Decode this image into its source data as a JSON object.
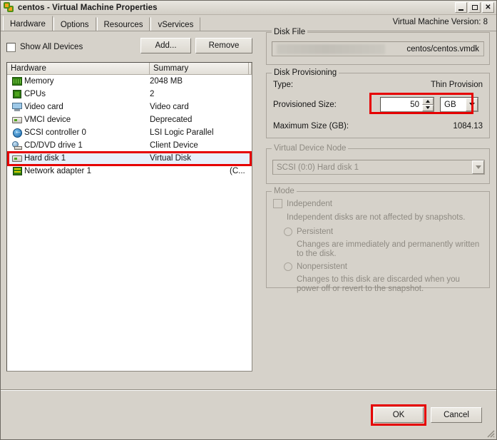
{
  "window": {
    "title": "centos - Virtual Machine Properties",
    "app_icon": "vsphere-icon",
    "minimize": "minimize-icon",
    "maximize": "maximize-icon",
    "close": "close-icon"
  },
  "tabs": [
    {
      "label": "Hardware",
      "active": true
    },
    {
      "label": "Options",
      "active": false
    },
    {
      "label": "Resources",
      "active": false
    },
    {
      "label": "vServices",
      "active": false
    }
  ],
  "left_pane": {
    "show_all_devices_label": "Show All Devices",
    "show_all_devices_checked": false,
    "add_button": "Add...",
    "remove_button": "Remove",
    "columns": [
      "Hardware",
      "Summary"
    ],
    "rows": [
      {
        "icon": "memory-icon",
        "name": "Memory",
        "summary": "2048 MB",
        "selected": false
      },
      {
        "icon": "cpu-icon",
        "name": "CPUs",
        "summary": "2",
        "selected": false
      },
      {
        "icon": "video-icon",
        "name": "Video card",
        "summary": "Video card",
        "selected": false
      },
      {
        "icon": "device-icon",
        "name": "VMCI device",
        "summary": "Deprecated",
        "selected": false
      },
      {
        "icon": "scsi-icon",
        "name": "SCSI controller 0",
        "summary": "LSI Logic Parallel",
        "selected": false
      },
      {
        "icon": "cddvd-icon",
        "name": "CD/DVD drive 1",
        "summary": "Client Device",
        "selected": false
      },
      {
        "icon": "harddisk-icon",
        "name": "Hard disk 1",
        "summary": "Virtual Disk",
        "selected": true
      },
      {
        "icon": "network-icon",
        "name": "Network adapter 1",
        "summary": "(C...",
        "selected": false
      }
    ]
  },
  "right_pane": {
    "vm_version": "Virtual Machine Version: 8",
    "disk_file": {
      "group_label": "Disk File",
      "value": "centos/centos.vmdk"
    },
    "disk_provisioning": {
      "group_label": "Disk Provisioning",
      "type_label": "Type:",
      "type_value": "Thin Provision",
      "size_label": "Provisioned Size:",
      "size_value": "50",
      "size_unit": "GB",
      "max_label": "Maximum Size (GB):",
      "max_value": "1084.13"
    },
    "virtual_device_node": {
      "group_label": "Virtual Device Node",
      "value": "SCSI (0:0) Hard disk 1"
    },
    "mode": {
      "group_label": "Mode",
      "independent_label": "Independent",
      "independent_checked": false,
      "independent_desc": "Independent disks are not affected by snapshots.",
      "persistent_label": "Persistent",
      "persistent_desc": "Changes are immediately and permanently written to the disk.",
      "nonpersistent_label": "Nonpersistent",
      "nonpersistent_desc": "Changes to this disk are discarded when you power off or revert to the snapshot."
    }
  },
  "footer": {
    "ok_button": "OK",
    "cancel_button": "Cancel"
  },
  "annotations": {
    "highlight_color": "#e60000",
    "boxes": [
      "hard-disk-row",
      "provisioned-size-field",
      "ok-button"
    ]
  }
}
